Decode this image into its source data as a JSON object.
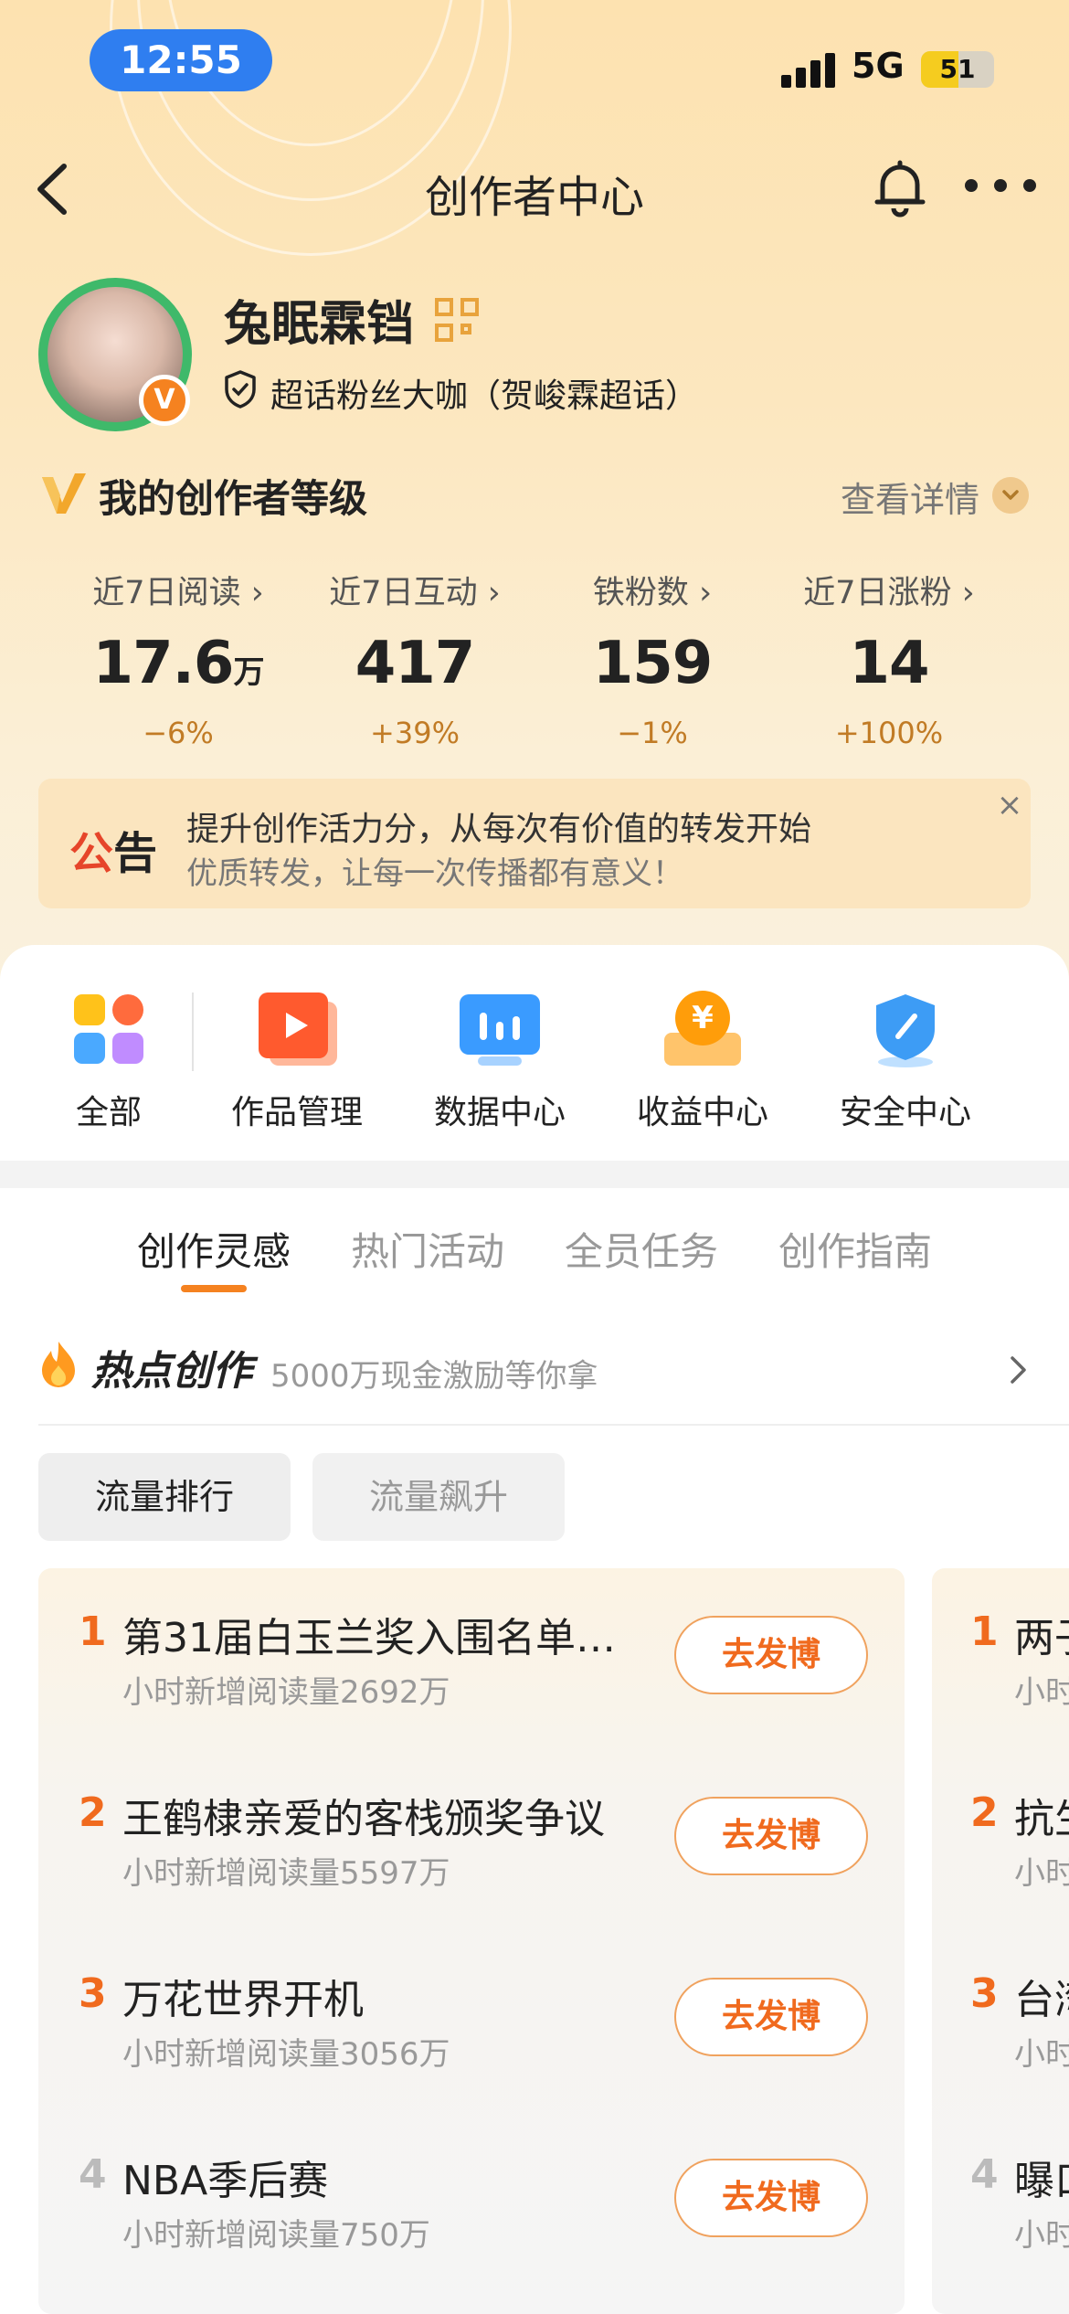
{
  "status": {
    "time": "12:55",
    "network": "5G",
    "battery": "51",
    "battery_level": 0.51
  },
  "nav": {
    "title": "创作者中心"
  },
  "profile": {
    "username": "兔眠霖铛",
    "fan_title": "超话粉丝大咖（贺峻霖超话）"
  },
  "level": {
    "title": "我的创作者等级",
    "detail_link": "查看详情"
  },
  "stats": [
    {
      "label": "近7日阅读",
      "value": "17.6",
      "unit": "万",
      "change": "−6%"
    },
    {
      "label": "近7日互动",
      "value": "417",
      "unit": "",
      "change": "+39%"
    },
    {
      "label": "铁粉数",
      "value": "159",
      "unit": "",
      "change": "−1%"
    },
    {
      "label": "近7日涨粉",
      "value": "14",
      "unit": "",
      "change": "+100%"
    }
  ],
  "notice": {
    "tag_part1": "公",
    "tag_part2": "告",
    "line1": "提升创作活力分，从每次有价值的转发开始",
    "line2": "优质转发，让每一次传播都有意义！"
  },
  "tools": [
    {
      "label": "全部",
      "icon": "grid-apps-icon"
    },
    {
      "label": "作品管理",
      "icon": "play-folder-icon"
    },
    {
      "label": "数据中心",
      "icon": "bar-chart-monitor-icon"
    },
    {
      "label": "收益中心",
      "icon": "yuan-coin-icon"
    },
    {
      "label": "安全中心",
      "icon": "shield-pen-icon"
    }
  ],
  "tabs": [
    "创作灵感",
    "热门活动",
    "全员任务",
    "创作指南"
  ],
  "hot": {
    "title": "热点创作",
    "subtitle": "5000万现金激励等你拿"
  },
  "chips": [
    "流量排行",
    "流量飙升"
  ],
  "ranking": [
    {
      "rank": "1",
      "title": "第31届白玉兰奖入围名单…",
      "sub": "小时新增阅读量2692万",
      "button": "去发博"
    },
    {
      "rank": "2",
      "title": "王鹤棣亲爱的客栈颁奖争议",
      "sub": "小时新增阅读量5597万",
      "button": "去发博"
    },
    {
      "rank": "3",
      "title": "万花世界开机",
      "sub": "小时新增阅读量3056万",
      "button": "去发博"
    },
    {
      "rank": "4",
      "title": "NBA季后赛",
      "sub": "小时新增阅读量750万",
      "button": "去发博"
    }
  ],
  "ranking2": [
    {
      "rank": "1",
      "title": "两子",
      "sub": "小时"
    },
    {
      "rank": "2",
      "title": "抗生",
      "sub": "小时"
    },
    {
      "rank": "3",
      "title": "台湾",
      "sub": "小时"
    },
    {
      "rank": "4",
      "title": "曝口",
      "sub": "小时"
    }
  ],
  "colors": {
    "accent": "#f06a1e",
    "status_pill": "#2f7ef0",
    "header_bg": "#fde2b0",
    "notice_red": "#e6452a"
  }
}
